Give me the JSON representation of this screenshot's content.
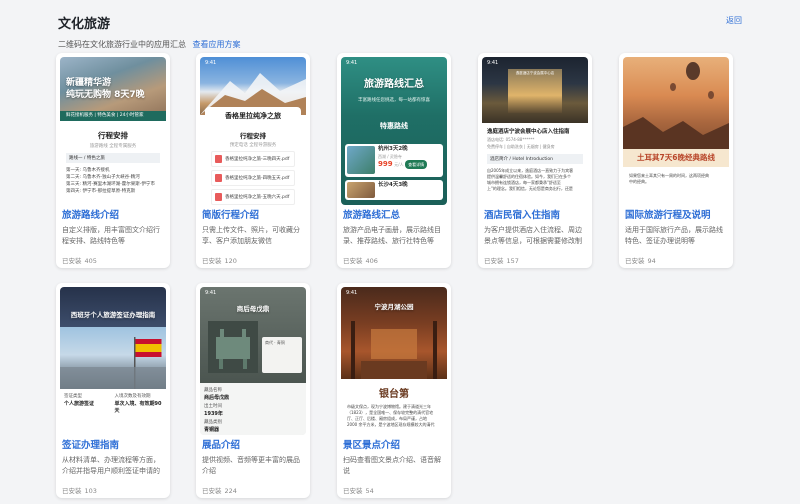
{
  "header": {
    "title": "文化旅游",
    "subtitle": "二维码在文化旅游行业中的应用汇总",
    "solution_link": "查看应用方案",
    "back": "返回"
  },
  "installs_label": "已安装",
  "cards": [
    {
      "title": "旅游路线介绍",
      "desc": "自定义排版，用丰富图文介绍行程安排、路线特色等",
      "installs": "405",
      "preview": {
        "hero_line1": "新疆精华游",
        "hero_line2": "纯玩无购物 8天7晚",
        "strip": "鲜花接机服务 | 特色美食 | 24小时管家",
        "heading": "行程安排",
        "sub": "旅游路线 全程专属服务",
        "tag": "路线一 / 特色之旅",
        "lines": [
          "第一天: 乌鲁木齐接机",
          "第二天: 乌鲁木齐-独山子大峡谷-精河",
          "第三天: 精河-赛里木湖环湖-霍尔果斯-伊宁市",
          "第四天: 伊宁市-那拉提草原-特克斯"
        ]
      }
    },
    {
      "title": "简版行程介绍",
      "desc": "只需上传文件、照片，可收藏分享、客户添加朋友微信",
      "installs": "120",
      "preview": {
        "time": "9:41",
        "hero_title": "香格里拉纯净之旅",
        "heading": "行程安排",
        "sub": "预定电话 全程导游服务",
        "files": [
          "香格里拉纯净之旅-三晚四天.pdf",
          "香格里拉纯净之旅-四晚五天.pdf",
          "香格里拉纯净之旅-五晚六天.pdf"
        ]
      }
    },
    {
      "title": "旅游路线汇总",
      "desc": "旅游产品电子画册，展示路线目录、推荐路线、旅行社特色等",
      "installs": "406",
      "preview": {
        "time": "9:41",
        "hero_title": "旅游路线汇总",
        "hero_sub": "丰富路线任您挑选，每一站都有惊喜",
        "section": "特惠路线",
        "item1_title": "杭州3天2晚",
        "item1_sub": "西湖 / 灵隐寺",
        "item1_price": "999",
        "item1_unit": "元/人",
        "item1_btn": "查看详情",
        "item2_title": "长沙4天3晚"
      }
    },
    {
      "title": "酒店民宿入住指南",
      "desc": "为客户提供酒店入住流程、周边景点等信息，可根据需要修改制作",
      "installs": "157",
      "preview": {
        "time": "9:41",
        "hotel_name": "逸庭酒店宁波会展中心店",
        "heading": "逸庭酒店宁波会展中心店入住指南",
        "meta1": "酒店电话: 0574-88******",
        "meta2": "免费停车 | 自助洗衣 | 无烟房 | 健身房",
        "tag": "酒店简介 / Hotel Introduction",
        "lines": [
          "自2005年成立以来，逸庭酒店一直致力于为宾客",
          "提供温馨舒适的住宿体验。如今，我们已在多个",
          "城市拥有连锁酒店，每一家都秉承\"舒适至",
          "上\"的理念。我们相信，无论您是商务出行，还是"
        ]
      }
    },
    {
      "title": "国际旅游行程及说明",
      "desc": "适用于国际旅行产品，展示路线特色、签证办理说明等",
      "installs": "94",
      "preview": {
        "banner": "土耳其7天6晚经典路线",
        "lines": [
          "如果您来土耳其只有一周的时间，这两项经典",
          "中的经典。"
        ]
      }
    },
    {
      "title": "签证办理指南",
      "desc": "从材料清单、办理流程等方面，介绍并指导用户顺利签证申请的步...",
      "installs": "103",
      "preview": {
        "hero_title": "西班牙个人旅游签证办理指南",
        "f1_label": "签证类型",
        "f1_value": "个人旅游签证",
        "f2_label": "入境次数及有效期",
        "f2_value": "单次入境、有效期90天",
        "f3_label": "",
        "f3_value": ""
      }
    },
    {
      "title": "展品介绍",
      "desc": "提供视频、音频等更丰富的展品介绍",
      "installs": "224",
      "preview": {
        "time": "9:41",
        "hero_title": "商后母戊鼎",
        "caption": "商代 · 青铜",
        "f1_label": "藏品名称",
        "f1_value": "商后母戊鼎",
        "f2_label": "出土时间",
        "f2_value": "1939年",
        "f3_label": "藏品类别",
        "f3_value": "青铜器"
      }
    },
    {
      "title": "景区景点介绍",
      "desc": "扫码查看图文景点介绍、语音解说",
      "installs": "54",
      "preview": {
        "time": "9:41",
        "hero_title": "宁波月湖公园",
        "place": "银台第",
        "lines": [
          "市级文保点，现为宁波博物馆。建于清道光三年",
          "（1823），是全国唯一、保存较完整的清代官宅",
          "厅、正厅、后楼、厢房组成，布局严谨，占地",
          "2000 余平方米，是宁波地区现存规模较大的清代"
        ]
      }
    }
  ],
  "colors": {
    "accent": "#2f6fd6",
    "title": "#1f2329",
    "card_bg": "#ffffff",
    "page_bg": "#f3f4f6"
  }
}
